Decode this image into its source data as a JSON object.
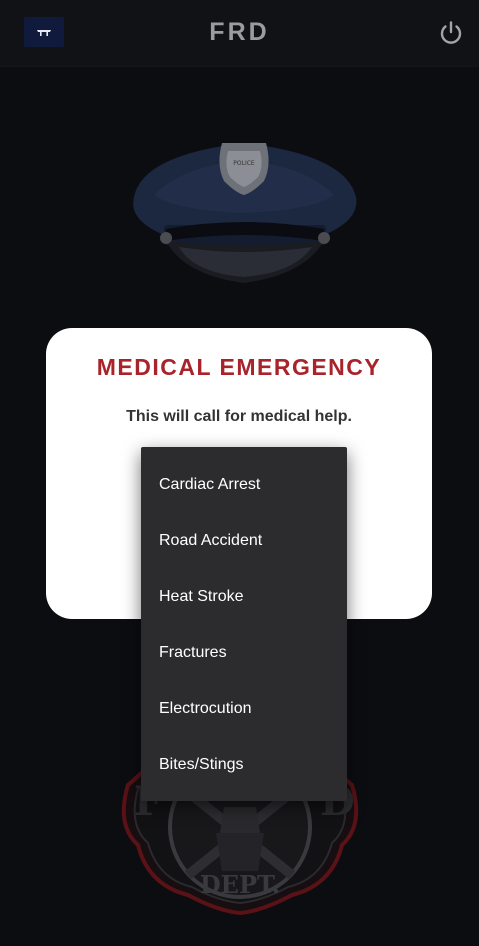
{
  "header": {
    "title": "FRD",
    "logo_icon": "police-cap-logo-icon",
    "power_icon": "power-icon"
  },
  "hat": {
    "badge_text": "POLICE"
  },
  "emblem": {
    "bottom_text": "DEPT.",
    "left_letter": "F",
    "right_letter": "D"
  },
  "modal": {
    "title": "MEDICAL EMERGENCY",
    "message": "This will call for medical help."
  },
  "dropdown": {
    "options": [
      {
        "label": "Cardiac Arrest"
      },
      {
        "label": "Road Accident"
      },
      {
        "label": "Heat Stroke"
      },
      {
        "label": "Fractures"
      },
      {
        "label": "Electrocution"
      },
      {
        "label": "Bites/Stings"
      }
    ]
  },
  "colors": {
    "background": "#0c0d11",
    "header": "#111216",
    "accent_red": "#a8232a",
    "menu_bg": "#2c2c2e"
  }
}
